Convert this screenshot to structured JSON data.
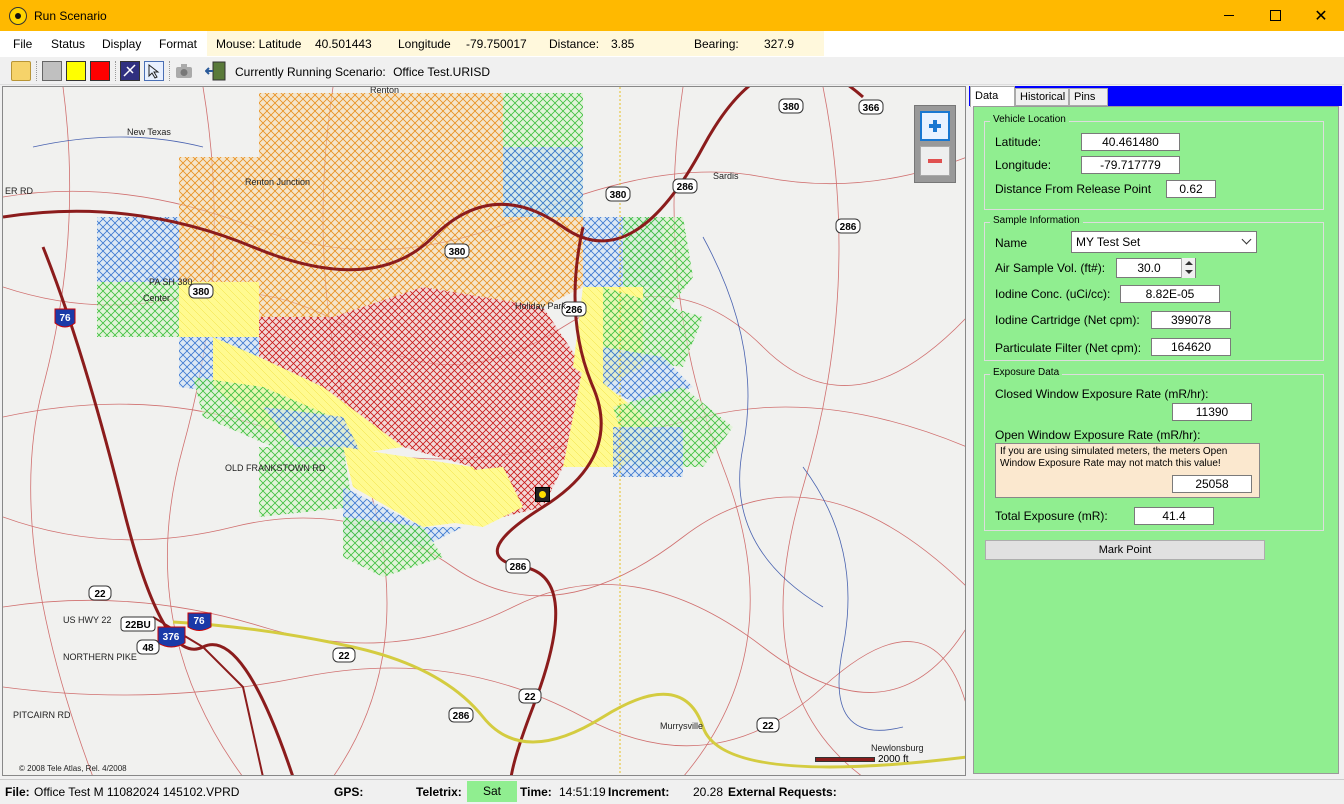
{
  "window": {
    "title": "Run Scenario",
    "accent_color": "#ffb900"
  },
  "menu": {
    "items": [
      "File",
      "Status",
      "Display",
      "Format"
    ]
  },
  "mouse_panel": {
    "latitude_label": "Mouse: Latitude",
    "latitude_value": "40.501443",
    "longitude_label": "Longitude",
    "longitude_value": "-79.750017",
    "distance_label": "Distance:",
    "distance_value": "3.85",
    "bearing_label": "Bearing:",
    "bearing_value": "327.9"
  },
  "toolbar": {
    "running_label": "Currently Running Scenario:",
    "running_value": "Office Test.URISD",
    "icons": [
      "open-folder-icon",
      "gray-square-icon",
      "yellow-square-icon",
      "red-square-icon",
      "satellite-icon",
      "pointer-icon",
      "camera-icon",
      "exit-door-icon"
    ]
  },
  "map": {
    "copyright": "© 2008 Tele Atlas, Rel. 4/2008",
    "scale": "2000 ft",
    "places": [
      "Renton",
      "New Texas",
      "Renton Junction",
      "Sardis",
      "Holiday Park",
      "Center",
      "Murrysville",
      "Newlonsburg"
    ],
    "route_shields": [
      "380",
      "366",
      "286",
      "76",
      "22",
      "48",
      "376",
      "22BU"
    ],
    "road_labels": [
      "ER RD",
      "PA SH 380",
      "US HWY 22",
      "NORTHERN PIKE",
      "OLD FRANKSTOWN RD",
      "PITCAIRN RD"
    ]
  },
  "tabs": [
    "Data",
    "Historical",
    "Pins"
  ],
  "vehicle_location": {
    "title": "Vehicle Location",
    "latitude_label": "Latitude:",
    "latitude_value": "40.461480",
    "longitude_label": "Longitude:",
    "longitude_value": "-79.717779",
    "distance_label": "Distance From Release Point",
    "distance_value": "0.62"
  },
  "sample_info": {
    "title": "Sample Information",
    "name_label": "Name",
    "name_value": "MY Test Set",
    "air_label": "Air Sample Vol. (ft#):",
    "air_value": "30.0",
    "iodine_conc_label": "Iodine Conc. (uCi/cc):",
    "iodine_conc_value": "8.82E-05",
    "iodine_cart_label": "Iodine Cartridge (Net cpm):",
    "iodine_cart_value": "399078",
    "particulate_label": "Particulate Filter (Net cpm):",
    "particulate_value": "164620"
  },
  "exposure": {
    "title": "Exposure Data",
    "closed_label": "Closed Window Exposure Rate (mR/hr):",
    "closed_value": "11390",
    "open_label": "Open Window Exposure Rate (mR/hr):",
    "warning": "If you are using simulated meters, the meters Open Window Exposure Rate may not match this value!",
    "open_value": "25058",
    "total_label": "Total Exposure (mR):",
    "total_value": "41.4"
  },
  "mark_point_label": "Mark Point",
  "statusbar": {
    "file_label": "File:",
    "file_value": "Office Test M 11082024 145102.VPRD",
    "gps_label": "GPS:",
    "teletrix_label": "Teletrix:",
    "teletrix_value": "Sat",
    "time_label": "Time:",
    "time_value": "14:51:19",
    "increment_label": "Increment:",
    "increment_value": "20.28",
    "external_label": "External Requests:"
  }
}
